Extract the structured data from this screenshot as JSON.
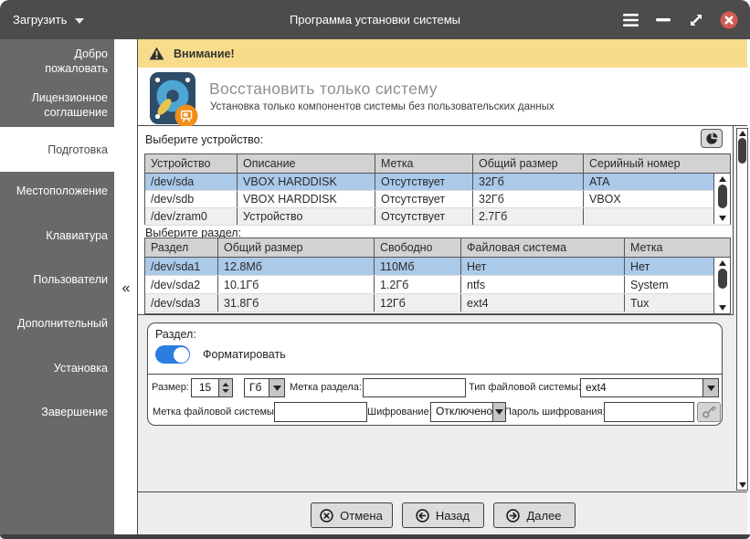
{
  "window": {
    "load_button": "Загрузить",
    "title": "Программа установки системы"
  },
  "sidebar": {
    "collapse": "«",
    "items": [
      {
        "label": "Добро пожаловать",
        "active": false
      },
      {
        "label": "Лицензионное соглашение",
        "active": false
      },
      {
        "label": "Подготовка",
        "active": true
      },
      {
        "label": "Местоположение",
        "active": false
      },
      {
        "label": "Клавиатура",
        "active": false
      },
      {
        "label": "Пользователи",
        "active": false
      },
      {
        "label": "Дополнительный",
        "active": false
      },
      {
        "label": "Установка",
        "active": false
      },
      {
        "label": "Завершение",
        "active": false
      }
    ]
  },
  "warning": {
    "text": "Внимание!"
  },
  "header": {
    "title": "Восстановить только систему",
    "subtitle": "Установка только компонентов системы без пользовательских данных"
  },
  "device_section": {
    "label": "Выберите устройство:",
    "columns": [
      "Устройство",
      "Описание",
      "Метка",
      "Общий размер",
      "Серийный номер"
    ],
    "rows": [
      [
        "/dev/sda",
        "VBOX HARDDISK",
        "Отсутствует",
        "32Гб",
        "ATA"
      ],
      [
        "/dev/sdb",
        "VBOX HARDDISK",
        "Отсутствует",
        "32Гб",
        "VBOX"
      ],
      [
        "/dev/zram0",
        "Устройство",
        "Отсутствует",
        "2.7Гб",
        ""
      ]
    ],
    "selected_row": 0
  },
  "partition_section": {
    "label": "Выберите раздел:",
    "columns": [
      "Раздел",
      "Общий размер",
      "Свободно",
      "Файловая система",
      "Метка"
    ],
    "rows": [
      [
        "/dev/sda1",
        "12.8Мб",
        "110Мб",
        "Нет",
        "Нет"
      ],
      [
        "/dev/sda2",
        "10.1Гб",
        "1.2Гб",
        "ntfs",
        "System"
      ],
      [
        "/dev/sda3",
        "31.8Гб",
        "12Гб",
        "ext4",
        "Tux"
      ]
    ],
    "selected_row": 0
  },
  "partition_form": {
    "title": "Раздел:",
    "format_toggle_label": "Форматировать",
    "format_on": true,
    "size_label": "Размер:",
    "size_value": "15",
    "unit_value": "Гб",
    "partition_label_label": "Метка раздела:",
    "partition_label_value": "",
    "fs_type_label": "Тип файловой системы:",
    "fs_type_value": "ext4",
    "fs_label_label": "Метка файловой системы:",
    "fs_label_value": "",
    "encryption_label": "Шифрование:",
    "encryption_value": "Отключено",
    "password_label": "Пароль шифрования:",
    "password_value": ""
  },
  "footer": {
    "cancel": "Отмена",
    "back": "Назад",
    "next": "Далее"
  },
  "colors": {
    "titlebar": "#4c4c4c",
    "sidebar": "#696969",
    "warning_bg": "#f8dc8c",
    "selection_blue": "#abc9e9",
    "toggle_on_blue": "#2d7de1",
    "close_red": "#d15b54",
    "badge_orange": "#f18f17",
    "disk_blue": "#4da6d3"
  }
}
